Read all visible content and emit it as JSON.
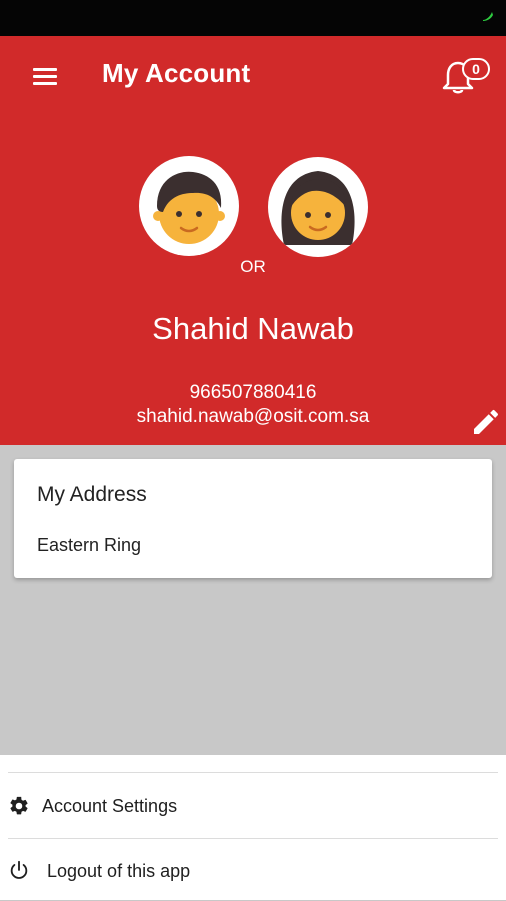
{
  "app": {
    "title": "My Account",
    "notification_count": "0"
  },
  "profile": {
    "or_text": "OR",
    "name": "Shahid Nawab",
    "phone": "966507880416",
    "email": "shahid.nawab@osit.com.sa"
  },
  "address": {
    "title": "My Address",
    "value": "Eastern Ring"
  },
  "menu": {
    "items": [
      {
        "label": "Account Settings",
        "icon": "gear-icon"
      },
      {
        "label": "Logout of this app",
        "icon": "power-icon"
      }
    ]
  },
  "colors": {
    "header": "#d12a2a",
    "background": "#c8c8c8",
    "status_bar": "#050505",
    "skin": "#f6b33c",
    "hair": "#3b2f2f"
  }
}
